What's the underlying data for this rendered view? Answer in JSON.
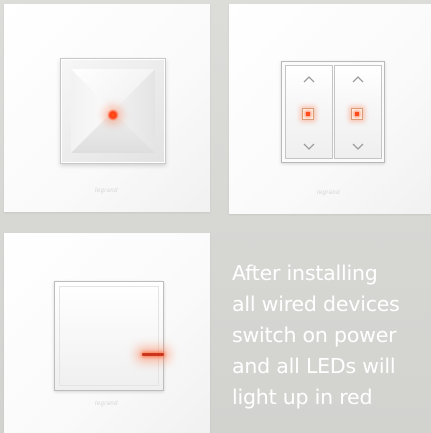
{
  "panels": [
    {
      "id": "pyramid-key",
      "brand": "legrand",
      "led": "center-dot"
    },
    {
      "id": "double-shutter-switch",
      "brand": "legrand",
      "led": "square-indicators"
    },
    {
      "id": "single-rocker-switch",
      "brand": "legrand",
      "led": "edge-bar"
    }
  ],
  "caption": {
    "lines": [
      "After installing",
      "all wired devices",
      "switch on power",
      "and all LEDs will",
      "light up in red"
    ]
  },
  "colors": {
    "background": "#d5d5d2",
    "plate": "#ffffff",
    "led_red": "#ff4a1c",
    "caption_text": "#ffffff"
  },
  "icons": [
    "chevron-up-icon",
    "chevron-down-icon"
  ]
}
